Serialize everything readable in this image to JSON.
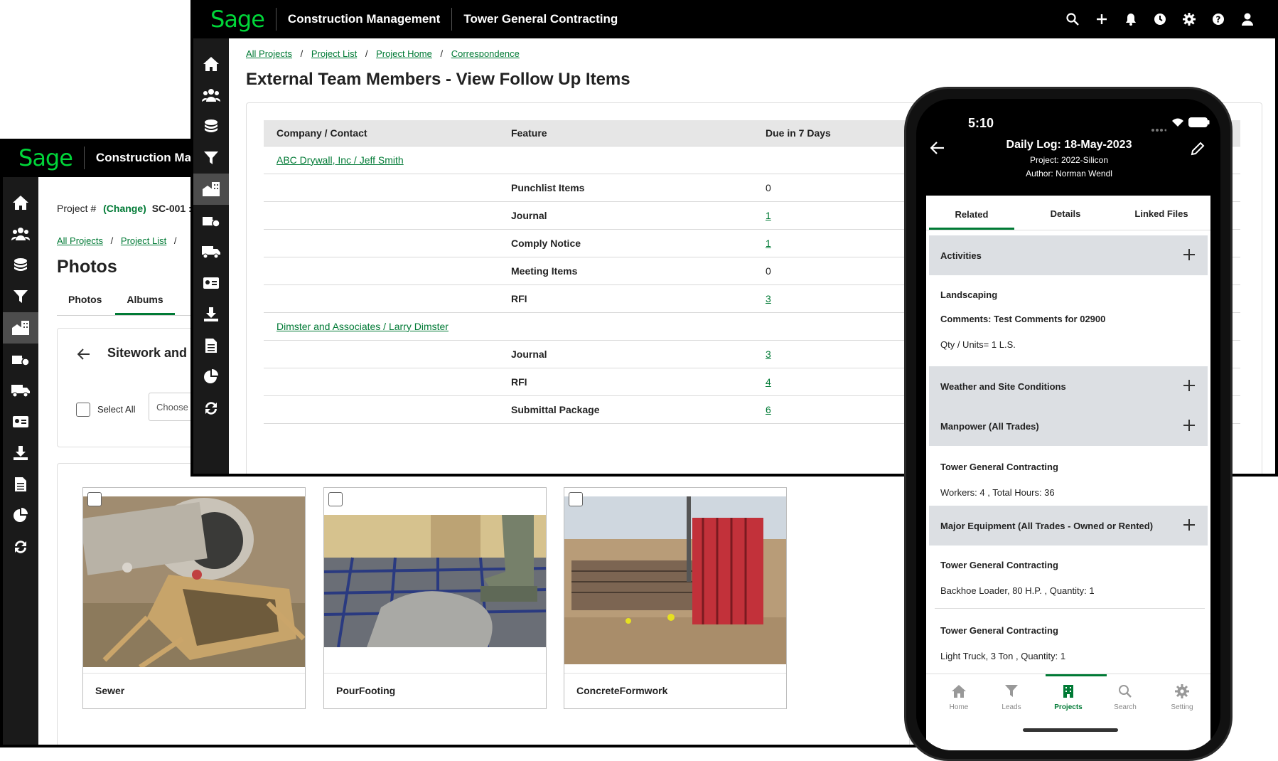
{
  "back_window": {
    "logo": "Sage",
    "app_title": "Construction Management",
    "project_label": "Project #",
    "change_link": "(Change)",
    "project_code": "SC-001 :",
    "breadcrumbs": [
      "All Projects",
      "Project List"
    ],
    "page_title": "Photos",
    "tabs": [
      "Photos",
      "Albums"
    ],
    "album_title": "Sitework and Concrete",
    "select_all": "Select All",
    "choose_placeholder": "Choose",
    "photos": [
      "Sewer",
      "PourFooting",
      "ConcreteFormwork"
    ]
  },
  "front_window": {
    "logo": "Sage",
    "app_title": "Construction Management",
    "company": "Tower General Contracting",
    "breadcrumbs": [
      "All Projects",
      "Project List",
      "Project Home",
      "Correspondence"
    ],
    "page_title": "External Team Members - View Follow Up Items",
    "columns": [
      "Company / Contact",
      "Feature",
      "Due in 7 Days"
    ],
    "groups": [
      {
        "contact": "ABC Drywall, Inc / Jeff Smith",
        "rows": [
          {
            "feature": "Punchlist Items",
            "due": "0",
            "link": false
          },
          {
            "feature": "Journal",
            "due": "1",
            "link": true
          },
          {
            "feature": "Comply Notice",
            "due": "1",
            "link": true
          },
          {
            "feature": "Meeting Items",
            "due": "0",
            "link": false
          },
          {
            "feature": "RFI",
            "due": "3",
            "link": true
          }
        ]
      },
      {
        "contact": "Dimster and Associates / Larry Dimster",
        "rows": [
          {
            "feature": "Journal",
            "due": "3",
            "link": true
          },
          {
            "feature": "RFI",
            "due": "4",
            "link": true
          },
          {
            "feature": "Submittal Package",
            "due": "6",
            "link": true
          }
        ]
      }
    ]
  },
  "phone": {
    "time": "5:10",
    "title": "Daily Log: 18-May-2023",
    "project": "Project: 2022-Silicon",
    "author": "Author: Norman Wendl",
    "tabs": [
      "Related",
      "Details",
      "Linked Files"
    ],
    "sections": {
      "activities": "Activities",
      "activity_name": "Landscaping",
      "activity_comments": "Comments: Test Comments for 02900",
      "activity_qty": "Qty / Units= 1 L.S.",
      "weather": "Weather and Site Conditions",
      "manpower": "Manpower (All Trades)",
      "manpower_company": "Tower General Contracting",
      "manpower_detail": "Workers: 4 , Total Hours: 36",
      "equipment": "Major Equipment (All Trades - Owned or Rented)",
      "equip1_company": "Tower General Contracting",
      "equip1_detail": "Backhoe Loader, 80 H.P. , Quantity: 1",
      "equip2_company": "Tower General Contracting",
      "equip2_detail": "Light Truck, 3 Ton , Quantity: 1"
    },
    "nav": [
      "Home",
      "Leads",
      "Projects",
      "Search",
      "Setting"
    ]
  },
  "colors": {
    "brand_green": "#00d639",
    "link_green": "#007a35",
    "active_tab": "#007a35"
  }
}
